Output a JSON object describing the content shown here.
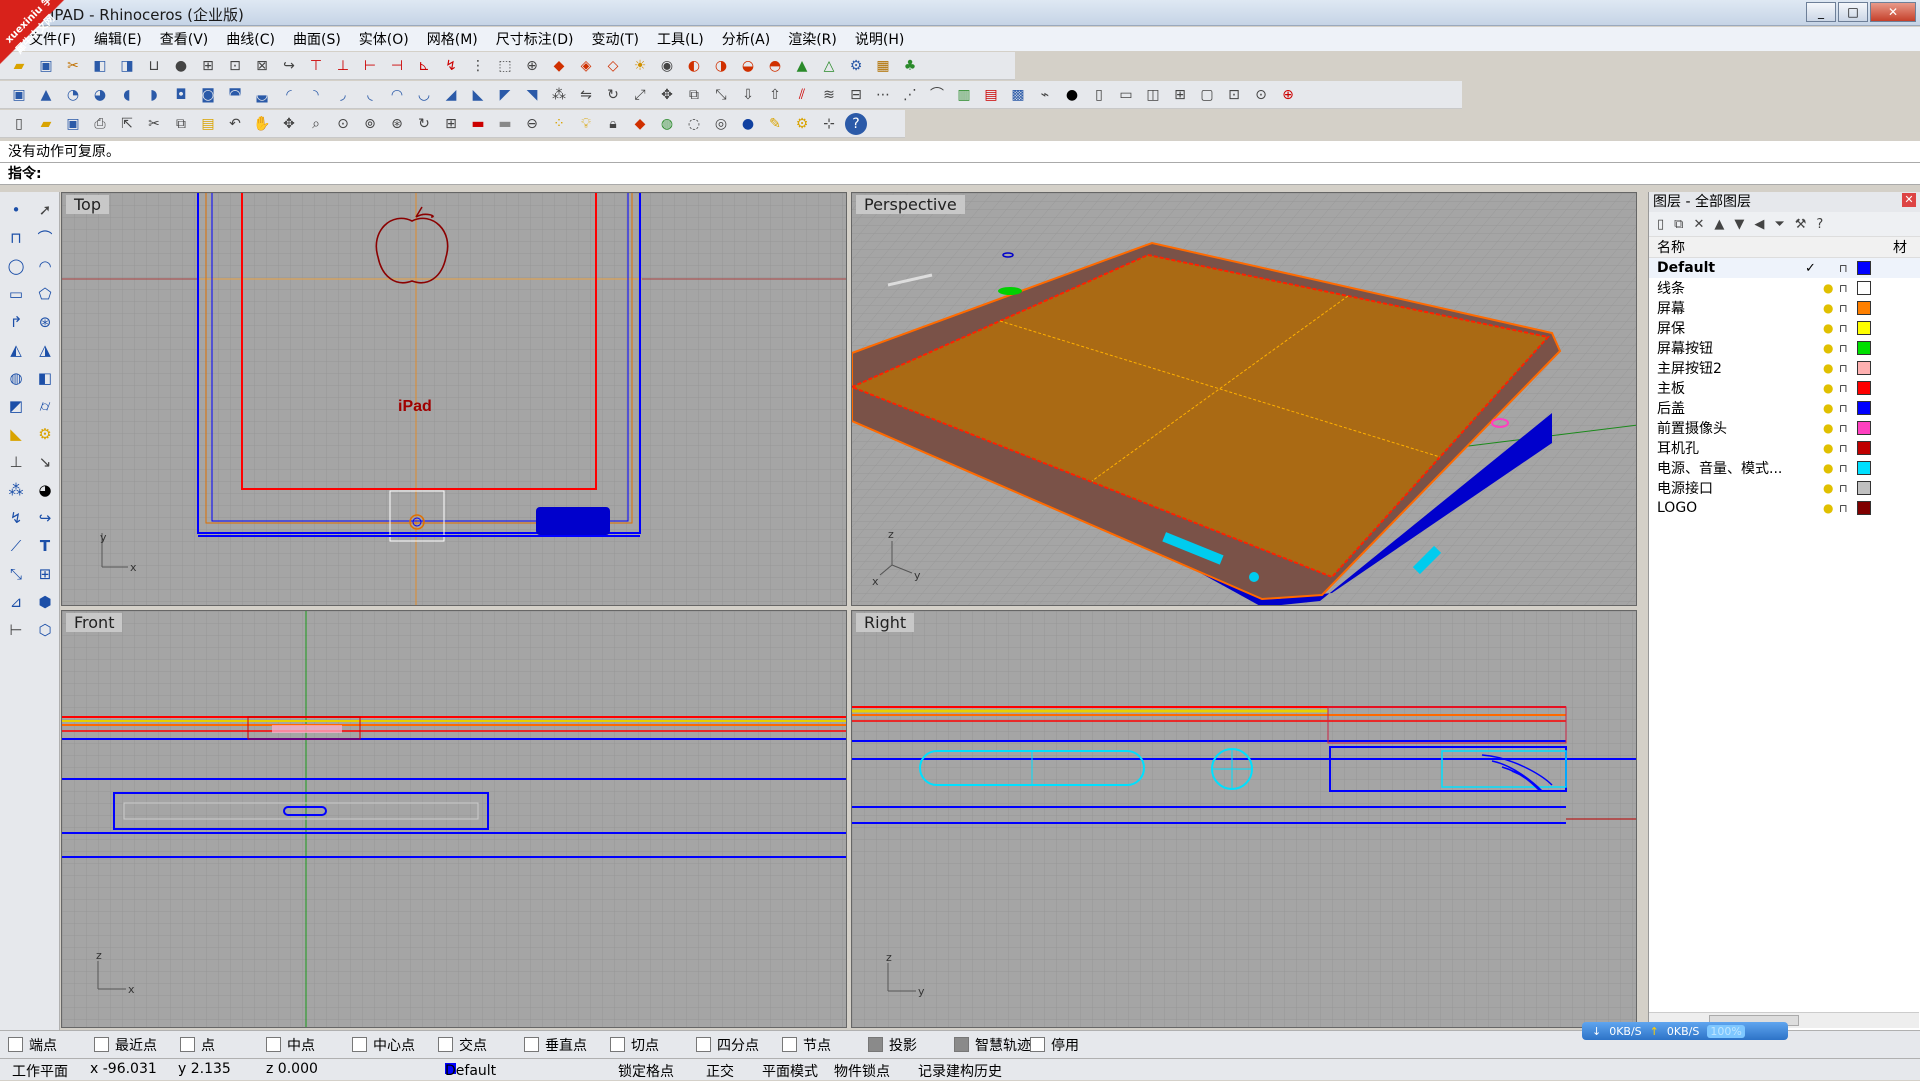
{
  "window": {
    "title": "IPAD - Rhinoceros (企业版)",
    "watermark": "xuexiniu 学犀牛中文网",
    "controls": [
      "_",
      "□",
      "✕"
    ]
  },
  "menu": [
    "文件(F)",
    "编辑(E)",
    "查看(V)",
    "曲线(C)",
    "曲面(S)",
    "实体(O)",
    "网格(M)",
    "尺寸标注(D)",
    "变动(T)",
    "工具(L)",
    "分析(A)",
    "渲染(R)",
    "说明(H)"
  ],
  "command": {
    "history": "没有动作可复原。",
    "prompt": "指令:"
  },
  "viewports": {
    "top": {
      "label": "Top",
      "axis_x": "x",
      "axis_y": "y",
      "logo_text": "iPad"
    },
    "perspective": {
      "label": "Perspective",
      "axis_x": "x",
      "axis_y": "y",
      "axis_z": "z"
    },
    "front": {
      "label": "Front",
      "axis_x": "x",
      "axis_z": "z"
    },
    "right": {
      "label": "Right",
      "axis_y": "y",
      "axis_z": "z"
    }
  },
  "layers_panel": {
    "title": "图层 - 全部图层",
    "col_name": "名称",
    "col_material": "材质",
    "current_mark": "✓",
    "layers": [
      {
        "name": "Default",
        "color": "#0000ff",
        "current": true
      },
      {
        "name": "线条",
        "color": "#ffffff"
      },
      {
        "name": "屏幕",
        "color": "#ff8000"
      },
      {
        "name": "屏保",
        "color": "#ffff00"
      },
      {
        "name": "屏幕按钮",
        "color": "#00e000"
      },
      {
        "name": "主屏按钮2",
        "color": "#ffb0b0"
      },
      {
        "name": "主板",
        "color": "#ff0000"
      },
      {
        "name": "后盖",
        "color": "#0000ff"
      },
      {
        "name": "前置摄像头",
        "color": "#ff40c0"
      },
      {
        "name": "耳机孔",
        "color": "#c00000"
      },
      {
        "name": "电源、音量、模式...",
        "color": "#00e0ff"
      },
      {
        "name": "电源接口",
        "color": "#c0c0c0"
      },
      {
        "name": "LOGO",
        "color": "#800000"
      }
    ]
  },
  "osnaps": [
    {
      "label": "端点",
      "on": false
    },
    {
      "label": "最近点",
      "on": false
    },
    {
      "label": "点",
      "on": false
    },
    {
      "label": "中点",
      "on": false
    },
    {
      "label": "中心点",
      "on": false
    },
    {
      "label": "交点",
      "on": false
    },
    {
      "label": "垂直点",
      "on": false
    },
    {
      "label": "切点",
      "on": false
    },
    {
      "label": "四分点",
      "on": false
    },
    {
      "label": "节点",
      "on": false
    },
    {
      "label": "投影",
      "on": true
    },
    {
      "label": "智慧轨迹",
      "on": true
    },
    {
      "label": "停用",
      "on": false
    }
  ],
  "network": {
    "down": "0KB/S",
    "up": "0KB/S",
    "percent": "100%"
  },
  "status": {
    "plane": "工作平面",
    "x": "x -96.031",
    "y": "y 2.135",
    "z": "z 0.000",
    "layer": "Default",
    "grid_snap": "锁定格点",
    "ortho": "正交",
    "planar": "平面模式",
    "osnap": "物件锁点",
    "history": "记录建构历史"
  }
}
